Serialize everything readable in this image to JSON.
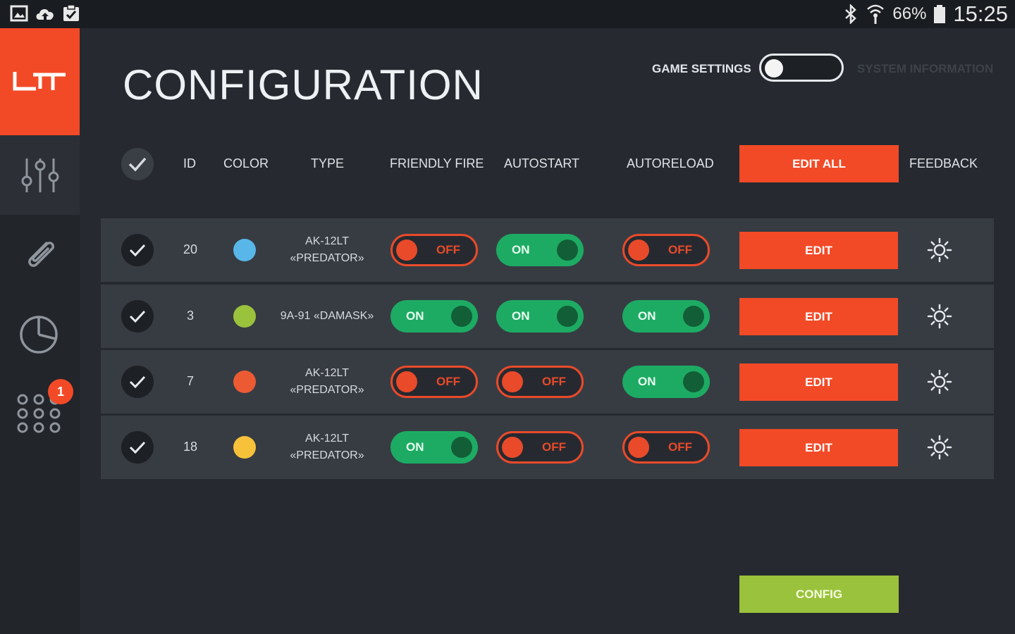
{
  "status_bar": {
    "icons": [
      "gallery-icon",
      "cloud-upload-icon",
      "clipboard-icon",
      "bluetooth-icon",
      "wifi-icon",
      "battery-icon"
    ],
    "battery": "66%",
    "time": "15:25"
  },
  "sidebar": {
    "logo_text": "LT",
    "items": [
      "sliders-icon",
      "paperclip-icon",
      "pie-chart-icon",
      "grid-dots-icon"
    ],
    "badge": "1"
  },
  "header": {
    "title": "CONFIGURATION",
    "left_mode": "GAME SETTINGS",
    "right_mode": "SYSTEM INFORMATION"
  },
  "columns": {
    "id": "ID",
    "color": "COLOR",
    "type": "TYPE",
    "friendly_fire": "FRIENDLY FIRE",
    "autostart": "AUTOSTART",
    "autoreload": "AUTORELOAD",
    "edit_all": "EDIT ALL",
    "feedback": "FEEDBACK"
  },
  "rows": [
    {
      "id": "20",
      "color": "#58b7e8",
      "type_line1": "AK-12LT",
      "type_line2": "«PREDATOR»",
      "friendly_fire": "OFF",
      "autostart": "ON",
      "autoreload": "OFF",
      "edit": "EDIT"
    },
    {
      "id": "3",
      "color": "#9ac23c",
      "type_line1": "9A-91 «DAMASK»",
      "type_line2": "",
      "friendly_fire": "ON",
      "autostart": "ON",
      "autoreload": "ON",
      "edit": "EDIT"
    },
    {
      "id": "7",
      "color": "#ec5a33",
      "type_line1": "AK-12LT",
      "type_line2": "«PREDATOR»",
      "friendly_fire": "OFF",
      "autostart": "OFF",
      "autoreload": "ON",
      "edit": "EDIT"
    },
    {
      "id": "18",
      "color": "#f7c23a",
      "type_line1": "AK-12LT",
      "type_line2": "«PREDATOR»",
      "friendly_fire": "ON",
      "autostart": "OFF",
      "autoreload": "OFF",
      "edit": "EDIT"
    }
  ],
  "config_button": "CONFIG",
  "colors": {
    "accent": "#f24a27",
    "on": "#1dab63",
    "off": "#e94a2a",
    "config": "#9ac23c"
  }
}
